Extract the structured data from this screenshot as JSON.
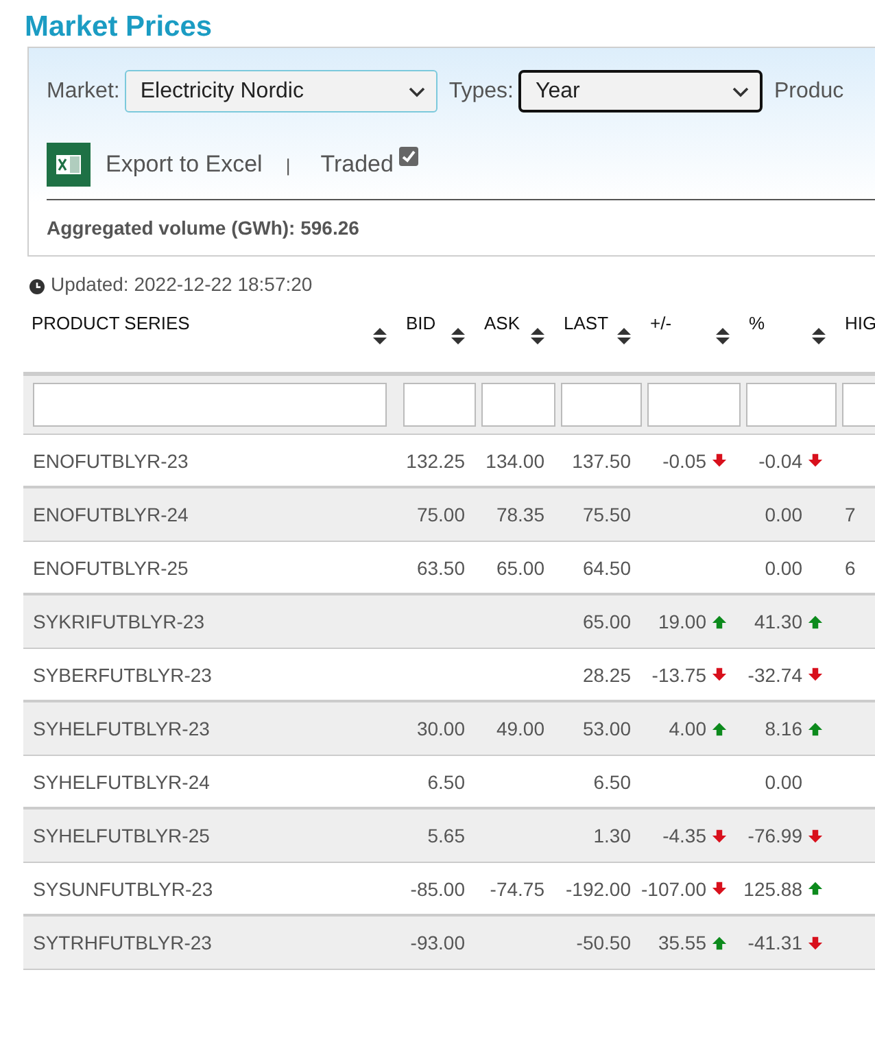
{
  "title": "Market Prices",
  "filters": {
    "market": {
      "label": "Market:",
      "value": "Electricity Nordic",
      "focused": false
    },
    "types": {
      "label": "Types:",
      "value": "Year",
      "focused": true
    },
    "product_label": "Produc"
  },
  "toolbar": {
    "export_label": "Export to Excel",
    "separator": "|",
    "traded": {
      "label": "Traded",
      "checked": true
    }
  },
  "aggregated": "Aggregated volume (GWh): 596.26",
  "updated": "Updated: 2022-12-22 18:57:20",
  "table": {
    "columns": [
      {
        "label": "PRODUCT SERIES",
        "sortable": true
      },
      {
        "label": "BID",
        "sortable": true
      },
      {
        "label": "ASK",
        "sortable": true
      },
      {
        "label": "LAST",
        "sortable": true
      },
      {
        "label": "+/-",
        "sortable": true
      },
      {
        "label": "%",
        "sortable": true
      },
      {
        "label": "HIG",
        "sortable": false
      }
    ],
    "rows": [
      {
        "product": "ENOFUTBLYR-23",
        "bid": "132.25",
        "ask": "134.00",
        "last": "137.50",
        "change": {
          "value": "-0.05",
          "rising": false
        },
        "percent": {
          "value": "-0.04",
          "rising": false
        }
      },
      {
        "product": "ENOFUTBLYR-24",
        "bid": "75.00",
        "ask": "78.35",
        "last": "75.50",
        "percent": {
          "value": "0.00"
        },
        "high": "7"
      },
      {
        "product": "ENOFUTBLYR-25",
        "bid": "63.50",
        "ask": "65.00",
        "last": "64.50",
        "percent": {
          "value": "0.00"
        },
        "high": "6"
      },
      {
        "product": "SYKRIFUTBLYR-23",
        "last": "65.00",
        "change": {
          "value": "19.00",
          "rising": true
        },
        "percent": {
          "value": "41.30",
          "rising": true
        }
      },
      {
        "product": "SYBERFUTBLYR-23",
        "last": "28.25",
        "change": {
          "value": "-13.75",
          "rising": false
        },
        "percent": {
          "value": "-32.74",
          "rising": false
        }
      },
      {
        "product": "SYHELFUTBLYR-23",
        "bid": "30.00",
        "ask": "49.00",
        "last": "53.00",
        "change": {
          "value": "4.00",
          "rising": true
        },
        "percent": {
          "value": "8.16",
          "rising": true
        }
      },
      {
        "product": "SYHELFUTBLYR-24",
        "bid": "6.50",
        "last": "6.50",
        "percent": {
          "value": "0.00"
        }
      },
      {
        "product": "SYHELFUTBLYR-25",
        "bid": "5.65",
        "last": "1.30",
        "change": {
          "value": "-4.35",
          "rising": false
        },
        "percent": {
          "value": "-76.99",
          "rising": false
        }
      },
      {
        "product": "SYSUNFUTBLYR-23",
        "bid": "-85.00",
        "ask": "-74.75",
        "last": "-192.00",
        "change": {
          "value": "-107.00",
          "rising": false
        },
        "percent": {
          "value": "125.88",
          "rising": true
        }
      },
      {
        "product": "SYTRHFUTBLYR-23",
        "bid": "-93.00",
        "last": "-50.50",
        "change": {
          "value": "35.55",
          "rising": true
        },
        "percent": {
          "value": "-41.31",
          "rising": false
        }
      }
    ]
  }
}
